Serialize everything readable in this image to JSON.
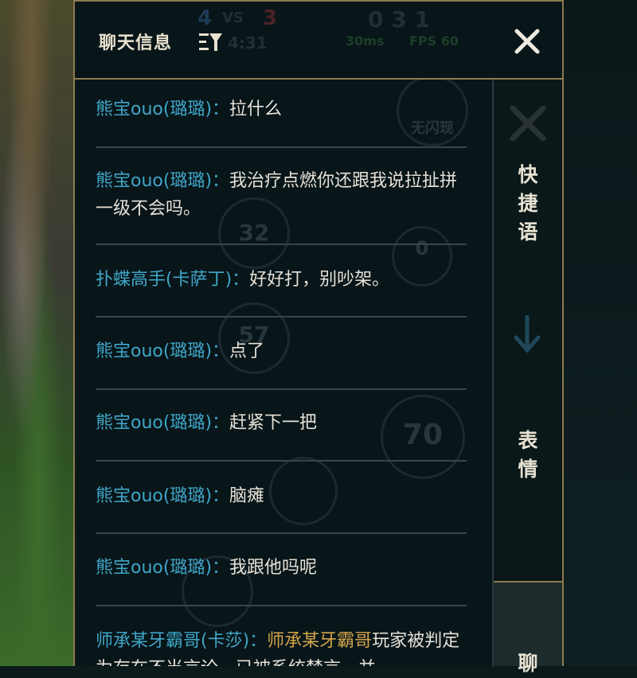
{
  "header": {
    "title": "聊天信息",
    "filter_icon": "filter-icon",
    "close_icon": "close-icon"
  },
  "hud_ghost": {
    "score_left": "4",
    "vs": "VS",
    "score_right": "3",
    "kda": "0 3 1",
    "timer": "4:31",
    "ping": "30ms",
    "fps": "FPS 60"
  },
  "messages": [
    {
      "name": "熊宝ouo(璐璐)：",
      "text": "拉什么"
    },
    {
      "name": "熊宝ouo(璐璐)：",
      "text": "我治疗点燃你还跟我说拉扯拼一级不会吗。"
    },
    {
      "name": "扑蝶高手(卡萨丁)：",
      "text": "好好打，别吵架。"
    },
    {
      "name": "熊宝ouo(璐璐)：",
      "text": "点了"
    },
    {
      "name": "熊宝ouo(璐璐)：",
      "text": "赶紧下一把"
    },
    {
      "name": "熊宝ouo(璐璐)：",
      "text": "脑瘫"
    },
    {
      "name": "熊宝ouo(璐璐)：",
      "text": "我跟他吗呢"
    },
    {
      "name": "师承某牙霸哥(卡莎)：",
      "highlight": "师承某牙霸哥",
      "text": "玩家被判定为存在不当言论，已被系统禁言，并"
    }
  ],
  "ghost_labels": {
    "flash": "无闪现",
    "n32": "32",
    "n57": "57",
    "n70": "70",
    "n0": "0"
  },
  "tabs": {
    "quick": "快捷语",
    "emoji": "表情",
    "chat": "聊"
  },
  "colors": {
    "name": "#3fa6c7",
    "highlight": "#d3a549",
    "border": "#8d7a4e"
  }
}
